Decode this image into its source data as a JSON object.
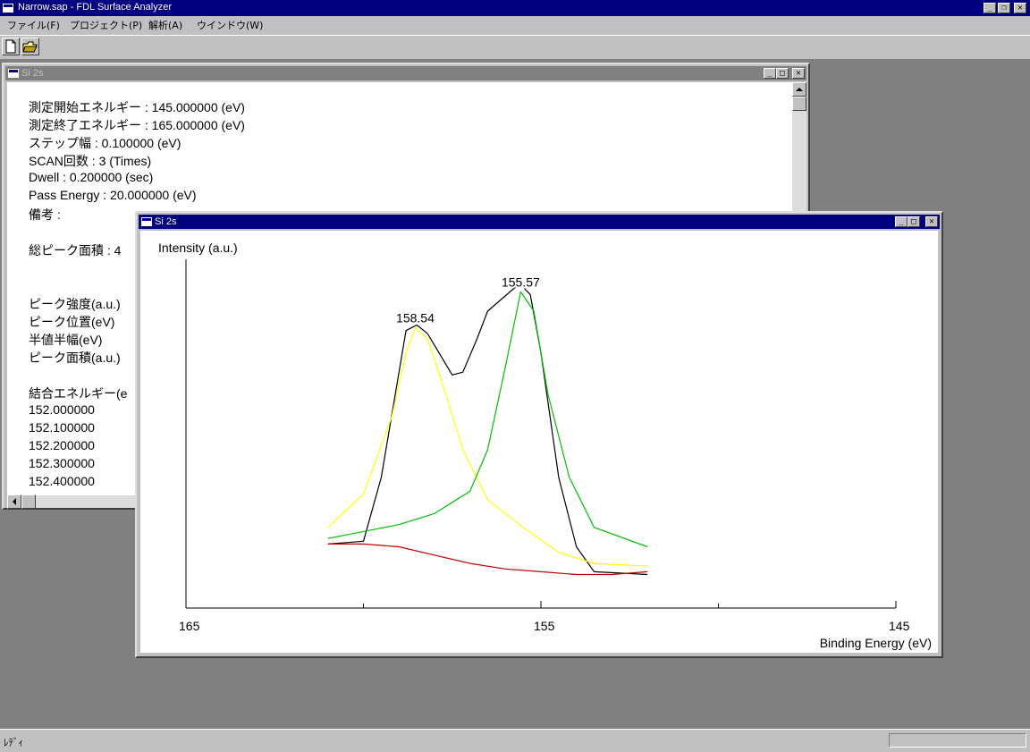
{
  "app": {
    "title": "Narrow.sap - FDL Surface Analyzer"
  },
  "menu": {
    "items": [
      "ファイル(F)",
      "プロジェクト(P)",
      "解析(A)",
      "ウインドウ(W)"
    ]
  },
  "toolbar": {
    "buttons": [
      "new-file-icon",
      "open-folder-icon"
    ]
  },
  "text_window": {
    "title": "Si 2s",
    "lines": [
      "測定開始エネルギー : 145.000000 (eV)",
      "測定終了エネルギー : 165.000000 (eV)",
      "ステップ幅 : 0.100000 (eV)",
      "SCAN回数 : 3 (Times)",
      "Dwell : 0.200000 (sec)",
      "Pass Energy : 20.000000 (eV)",
      "備考 :",
      "",
      "総ピーク面積 : 4",
      "",
      "",
      "ピーク強度(a.u.)",
      "ピーク位置(eV)",
      "半値半幅(eV)",
      "ピーク面積(a.u.)",
      "",
      "結合エネルギー(e",
      "152.000000",
      "152.100000",
      "152.200000",
      "152.300000",
      "152.400000"
    ]
  },
  "graph_window": {
    "title": "Si 2s"
  },
  "chart_data": {
    "type": "line",
    "ylabel": "Intensity (a.u.)",
    "xlabel": "Binding Energy (eV)",
    "xlim": [
      165,
      145
    ],
    "ylim": [
      0,
      1.0
    ],
    "x_ticks": [
      165,
      155,
      145
    ],
    "x_minor_ticks": [
      160,
      150
    ],
    "series": [
      {
        "color": "#000000",
        "points": [
          [
            161.0,
            0.16
          ],
          [
            160.0,
            0.17
          ],
          [
            159.5,
            0.4
          ],
          [
            158.8,
            0.93
          ],
          [
            158.5,
            0.95
          ],
          [
            158.2,
            0.92
          ],
          [
            157.5,
            0.77
          ],
          [
            157.2,
            0.78
          ],
          [
            156.8,
            0.9
          ],
          [
            156.5,
            1.0
          ],
          [
            155.6,
            1.1
          ],
          [
            155.3,
            1.06
          ],
          [
            155.0,
            0.85
          ],
          [
            154.5,
            0.4
          ],
          [
            154.0,
            0.15
          ],
          [
            153.5,
            0.06
          ],
          [
            152.0,
            0.05
          ]
        ]
      },
      {
        "color": "#ffff00",
        "points": [
          [
            161.0,
            0.22
          ],
          [
            160.0,
            0.34
          ],
          [
            159.2,
            0.62
          ],
          [
            158.8,
            0.85
          ],
          [
            158.54,
            0.94
          ],
          [
            158.2,
            0.9
          ],
          [
            157.8,
            0.75
          ],
          [
            157.2,
            0.5
          ],
          [
            156.5,
            0.32
          ],
          [
            155.5,
            0.22
          ],
          [
            154.5,
            0.13
          ],
          [
            153.5,
            0.09
          ],
          [
            152.0,
            0.08
          ]
        ]
      },
      {
        "color": "#00c000",
        "points": [
          [
            161.0,
            0.18
          ],
          [
            159.0,
            0.23
          ],
          [
            158.0,
            0.27
          ],
          [
            157.0,
            0.35
          ],
          [
            156.5,
            0.5
          ],
          [
            156.0,
            0.8
          ],
          [
            155.57,
            1.07
          ],
          [
            155.2,
            1.0
          ],
          [
            154.8,
            0.7
          ],
          [
            154.2,
            0.4
          ],
          [
            153.5,
            0.22
          ],
          [
            152.0,
            0.15
          ]
        ]
      },
      {
        "color": "#c00000",
        "points": [
          [
            161.0,
            0.16
          ],
          [
            160.0,
            0.16
          ],
          [
            159.0,
            0.15
          ],
          [
            158.0,
            0.12
          ],
          [
            157.0,
            0.09
          ],
          [
            156.0,
            0.07
          ],
          [
            155.0,
            0.06
          ],
          [
            154.0,
            0.05
          ],
          [
            153.0,
            0.05
          ],
          [
            152.0,
            0.06
          ]
        ]
      }
    ],
    "annotations": [
      {
        "label": "158.54",
        "x": 158.54,
        "y": 0.94
      },
      {
        "label": "155.57",
        "x": 155.57,
        "y": 1.07
      }
    ]
  },
  "status": {
    "text": "ﾚﾃﾞｨ"
  }
}
